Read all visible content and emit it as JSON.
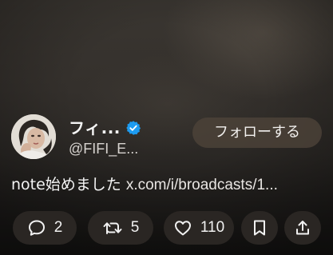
{
  "author": {
    "display_name": "フィ...",
    "handle": "@FIFI_E...",
    "verified": true,
    "avatar": "avatar-photo"
  },
  "follow_button": {
    "label": "フォローする"
  },
  "tweet": {
    "text": "note始めました",
    "link": "x.com/i/broadcasts/1..."
  },
  "actions": {
    "reply": {
      "icon": "reply-icon",
      "count": "2"
    },
    "repost": {
      "icon": "repost-icon",
      "count": "5"
    },
    "like": {
      "icon": "heart-icon",
      "count": "110"
    },
    "bookmark": {
      "icon": "bookmark-icon"
    },
    "share": {
      "icon": "share-icon"
    }
  },
  "colors": {
    "verified_badge": "#1d9bf0",
    "text": "#f4f4f4",
    "pill_background": "#2c2825",
    "follow_background": "#4e443a"
  }
}
